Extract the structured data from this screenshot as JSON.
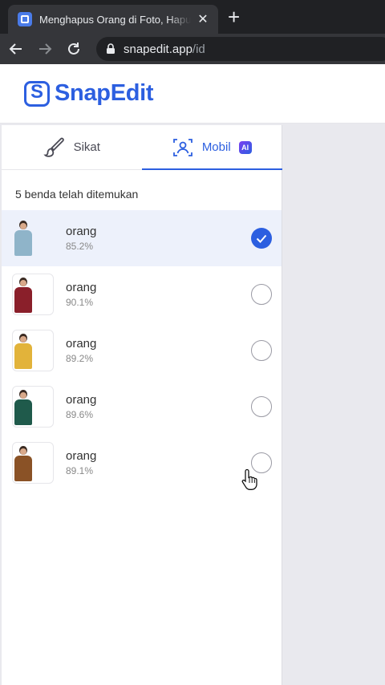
{
  "browser": {
    "tab_title": "Menghapus Orang di Foto, Hapus Orang",
    "tab_close": "✕",
    "new_tab": "+",
    "url_host": "snapedit.app",
    "url_path": "/id"
  },
  "app": {
    "logo_text": "SnapEdit",
    "brand_color": "#2c5fe0"
  },
  "panel": {
    "tabs": [
      {
        "label": "Sikat",
        "icon": "brush-icon",
        "active": false
      },
      {
        "label": "Mobil",
        "icon": "person-scan-icon",
        "active": true,
        "badge": "AI"
      }
    ],
    "found_text": "5 benda telah ditemukan",
    "items": [
      {
        "name": "orang",
        "confidence": "85.2%",
        "selected": true
      },
      {
        "name": "orang",
        "confidence": "90.1%",
        "selected": false
      },
      {
        "name": "orang",
        "confidence": "89.2%",
        "selected": false
      },
      {
        "name": "orang",
        "confidence": "89.6%",
        "selected": false
      },
      {
        "name": "orang",
        "confidence": "89.1%",
        "selected": false
      }
    ]
  }
}
